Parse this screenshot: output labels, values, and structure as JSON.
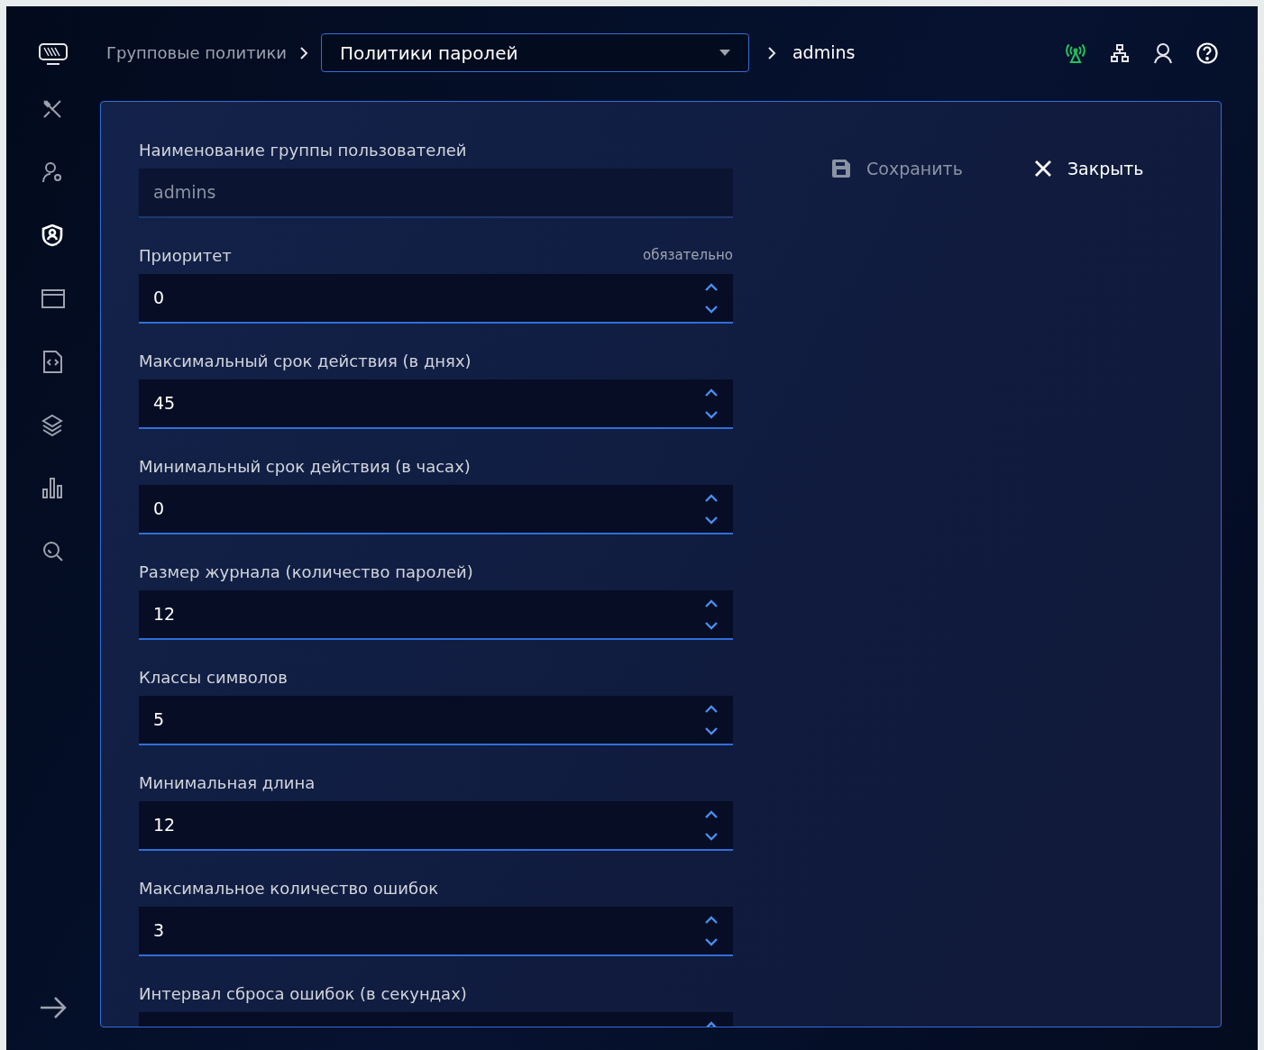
{
  "sidebar": {
    "items": [
      {
        "kind": "tools",
        "selected": false
      },
      {
        "kind": "usergear",
        "selected": false
      },
      {
        "kind": "shield",
        "selected": true
      },
      {
        "kind": "window",
        "selected": false
      },
      {
        "kind": "codefile",
        "selected": false
      },
      {
        "kind": "layers",
        "selected": false
      },
      {
        "kind": "chart",
        "selected": false
      },
      {
        "kind": "search",
        "selected": false
      }
    ]
  },
  "breadcrumb": {
    "root": "Групповые политики",
    "dropdown": "Политики паролей",
    "current": "admins"
  },
  "actions": [
    {
      "label": "Сохранить",
      "kind": "save",
      "disabled": true
    },
    {
      "label": "Закрыть",
      "kind": "close",
      "disabled": false
    }
  ],
  "fields": [
    {
      "label": "Наименование группы пользователей",
      "kind": "text",
      "value": "admins",
      "disabled": true
    },
    {
      "label": "Приоритет",
      "kind": "number",
      "value": "0",
      "disabled": false,
      "note": "обязательно"
    },
    {
      "label": "Максимальный срок действия (в днях)",
      "kind": "number",
      "value": "45",
      "disabled": false
    },
    {
      "label": "Минимальный срок действия (в часах)",
      "kind": "number",
      "value": "0",
      "disabled": false
    },
    {
      "label": "Размер журнала (количество паролей)",
      "kind": "number",
      "value": "12",
      "disabled": false
    },
    {
      "label": "Классы символов",
      "kind": "number",
      "value": "5",
      "disabled": false
    },
    {
      "label": "Минимальная длина",
      "kind": "number",
      "value": "12",
      "disabled": false
    },
    {
      "label": "Максимальное количество ошибок",
      "kind": "number",
      "value": "3",
      "disabled": false
    },
    {
      "label": "Интервал сброса ошибок (в секундах)",
      "kind": "number",
      "disabled": false
    }
  ]
}
